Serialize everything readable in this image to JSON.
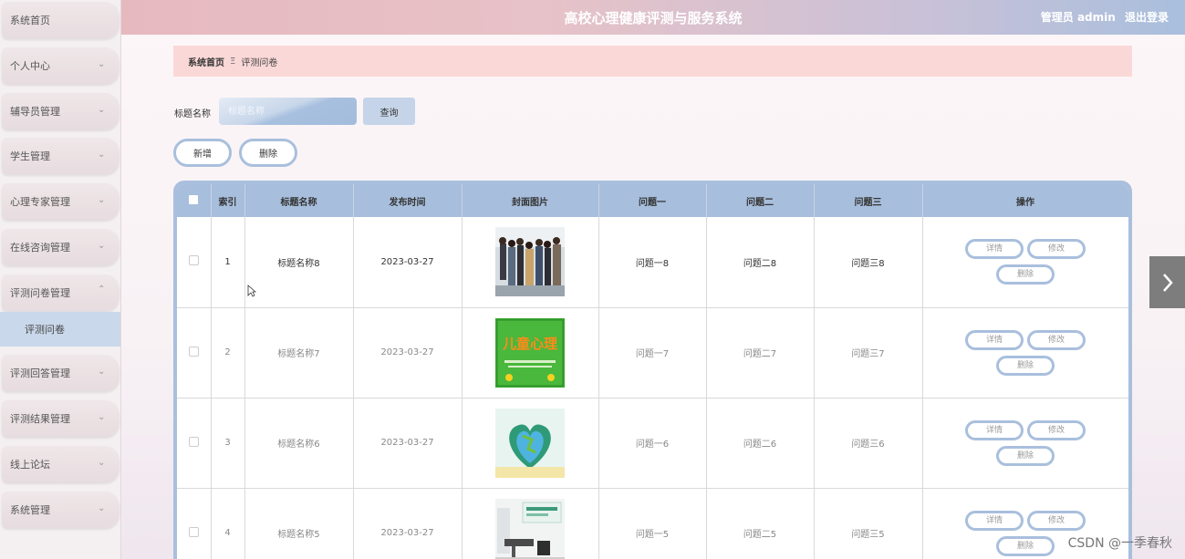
{
  "header": {
    "title": "高校心理健康评测与服务系统",
    "user": "管理员 admin",
    "logout": "退出登录"
  },
  "sidebar": {
    "items": [
      {
        "label": "系统首页"
      },
      {
        "label": "个人中心"
      },
      {
        "label": "辅导员管理"
      },
      {
        "label": "学生管理"
      },
      {
        "label": "心理专家管理"
      },
      {
        "label": "在线咨询管理"
      },
      {
        "label": "评测问卷管理"
      },
      {
        "label": "评测回答管理"
      },
      {
        "label": "评测结果管理"
      },
      {
        "label": "线上论坛"
      },
      {
        "label": "系统管理"
      }
    ],
    "submenu": {
      "label": "评测问卷"
    }
  },
  "breadcrumb": {
    "home": "系统首页",
    "separator": "Ξ",
    "current": "评测问卷"
  },
  "search": {
    "label": "标题名称",
    "placeholder": "标题名称",
    "button": "查询"
  },
  "actions": {
    "add": "新增",
    "delete": "删除"
  },
  "table": {
    "headers": [
      "索引",
      "标题名称",
      "发布时间",
      "封面图片",
      "问题一",
      "问题二",
      "问题三",
      "操作"
    ],
    "rows": [
      {
        "index": "1",
        "title": "标题名称8",
        "date": "2023-03-27",
        "q1": "问题一8",
        "q2": "问题二8",
        "q3": "问题三8"
      },
      {
        "index": "2",
        "title": "标题名称7",
        "date": "2023-03-27",
        "q1": "问题一7",
        "q2": "问题二7",
        "q3": "问题三7"
      },
      {
        "index": "3",
        "title": "标题名称6",
        "date": "2023-03-27",
        "q1": "问题一6",
        "q2": "问题二6",
        "q3": "问题三6"
      },
      {
        "index": "4",
        "title": "标题名称5",
        "date": "2023-03-27",
        "q1": "问题一5",
        "q2": "问题二5",
        "q3": "问题三5"
      }
    ],
    "op_labels": {
      "detail": "详情",
      "edit": "修改",
      "delete": "删除"
    }
  },
  "watermark": "CSDN @一季春秋",
  "colors": {
    "accent": "#a9bfdd",
    "breadcrumb_bg": "#fbd8d8",
    "active_menu": "#c9d8ea"
  }
}
